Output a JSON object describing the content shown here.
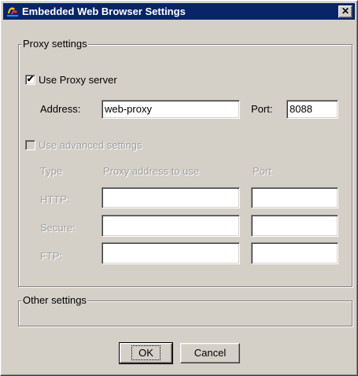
{
  "window": {
    "title": "Embedded Web Browser Settings"
  },
  "proxy_group": {
    "legend": "Proxy settings",
    "use_proxy": {
      "label": "Use Proxy server",
      "checked": true,
      "mark": "✔"
    },
    "address_label": "Address:",
    "address_value": "web-proxy",
    "port_label": "Port:",
    "port_value": "8088",
    "advanced": {
      "label": "Use advanced settings",
      "checked": false,
      "col_type": "Type",
      "col_address": "Proxy address to use",
      "col_port": "Port",
      "rows": [
        {
          "label": "HTTP:",
          "address": "",
          "port": ""
        },
        {
          "label": "Secure:",
          "address": "",
          "port": ""
        },
        {
          "label": "FTP:",
          "address": "",
          "port": ""
        }
      ]
    }
  },
  "other_group": {
    "legend": "Other settings"
  },
  "buttons": {
    "ok": "OK",
    "cancel": "Cancel"
  },
  "icons": {
    "title": "browser-settings-icon",
    "close": "close-icon"
  },
  "colors": {
    "titlebar": "#0a246a",
    "face": "#d4d0c8",
    "disabled_text": "#a0a0a0"
  }
}
